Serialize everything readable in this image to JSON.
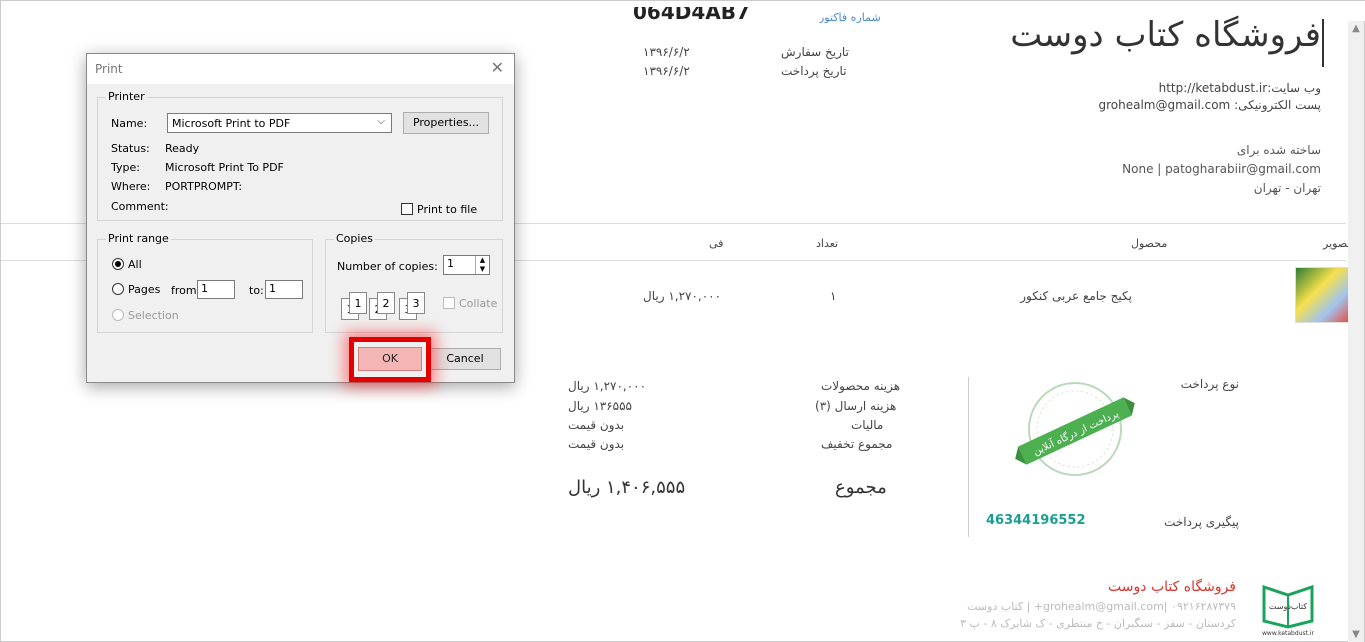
{
  "invoice": {
    "store_title": "فروشگاه کتاب دوست",
    "order_id": "064D4AB7",
    "order_id_label": "شماره فاکتور",
    "order_date_label": "تاریخ سفارش",
    "order_date": "۱۳۹۶/۶/۲",
    "payment_date_label": "تاریخ پرداخت",
    "payment_date": "۱۳۹۶/۶/۲",
    "website": "وب سایت:http://ketabdust.ir",
    "email": "پست الکترونیکی: grohealm@gmail.com",
    "made_for_label": "ساخته شده برای",
    "customer": "None | patogharabiir@gmail.com",
    "city": "تهران - تهران",
    "table_headers": {
      "image": "تصویر",
      "product": "محصول",
      "qty": "تعداد",
      "price": "فی"
    },
    "row": {
      "product": "پکیج جامع عربی کنکور",
      "qty": "۱",
      "price": "۱,۲۷۰,۰۰۰ ریال"
    },
    "payment_type_label": "نوع پرداخت",
    "stamp_text": "پرداخت از درگاه آنلاین",
    "tracking_label": "پیگیری پرداخت",
    "tracking_code": "46344196552",
    "summary": [
      {
        "label": "هزینه محصولات",
        "value": "۱,۲۷۰,۰۰۰ ریال"
      },
      {
        "label": "هزینه ارسال (۳)",
        "value": "۱۳۶۵۵۵ ریال"
      },
      {
        "label": "مالیات",
        "value": "بدون قیمت"
      },
      {
        "label": "مجموع تخفیف",
        "value": "بدون قیمت"
      }
    ],
    "total_label": "مجموع",
    "total_value": "۱,۴۰۶,۵۵۵ ریال",
    "footer_store": "فروشگاه کتاب دوست",
    "footer_line1": "grohealm@gmail.com| ۰۹۲۱۶۲۸۷۳۷۹+ | کتاب دوست",
    "footer_line2": "کردستان - سقز - سنگبران - خ منتظری - ک شایرک ۸ - پ ۳",
    "logo_text": "کتاب‌دوست",
    "logo_url": "www.ketabdust.ir"
  },
  "dialog": {
    "title": "Print",
    "printer_group": "Printer",
    "name_label": "Name:",
    "name_value": "Microsoft Print to PDF",
    "properties_button": "Properties...",
    "status_label": "Status:",
    "status_value": "Ready",
    "type_label": "Type:",
    "type_value": "Microsoft Print To PDF",
    "where_label": "Where:",
    "where_value": "PORTPROMPT:",
    "comment_label": "Comment:",
    "print_to_file": "Print to file",
    "print_range_group": "Print range",
    "all_label": "All",
    "pages_label": "Pages",
    "from_label": "from:",
    "from_value": "1",
    "to_label": "to:",
    "to_value": "1",
    "selection_label": "Selection",
    "copies_group": "Copies",
    "num_copies_label": "Number of copies:",
    "num_copies_value": "1",
    "collate_label": "Collate",
    "ok_button": "OK",
    "cancel_button": "Cancel"
  }
}
